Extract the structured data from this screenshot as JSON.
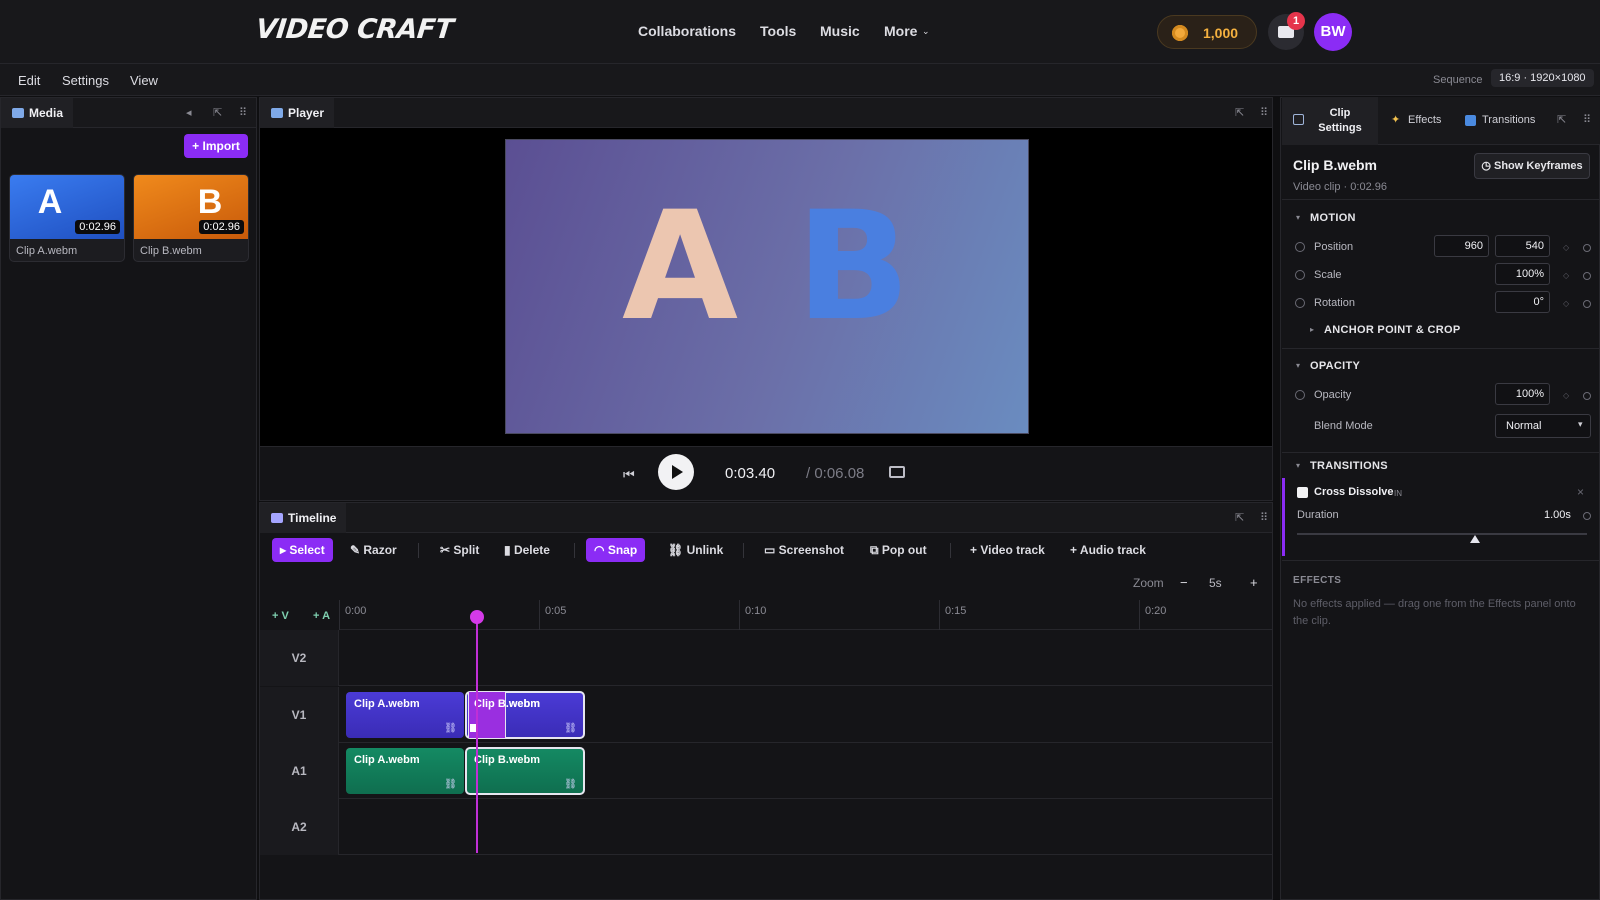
{
  "app": {
    "logo": "VIDEO CRAFT",
    "nav": [
      "Collaborations",
      "Tools",
      "Music",
      "More"
    ],
    "coins": "1,000",
    "notifications": "1",
    "avatar_initials": "BW"
  },
  "menubar": {
    "items": [
      "Edit",
      "Settings",
      "View"
    ],
    "sequence_label": "Sequence",
    "sequence_value": "16:9 · 1920×1080"
  },
  "media": {
    "tab": "Media",
    "import_label": "+ Import",
    "items": [
      {
        "letter": "A",
        "name": "Clip A.webm",
        "duration": "0:02.96",
        "color": "#2f6be0"
      },
      {
        "letter": "B",
        "name": "Clip B.webm",
        "duration": "0:02.96",
        "color": "#e8740f"
      }
    ]
  },
  "player": {
    "tab": "Player",
    "letter_a": "A",
    "letter_b": "B",
    "current_time": "0:03.40",
    "total_time": "/ 0:06.08"
  },
  "timeline": {
    "tab": "Timeline",
    "tools": [
      "Select",
      "Razor",
      "Split",
      "Delete",
      "Snap",
      "Unlink",
      "Screenshot",
      "Pop out",
      "+ Video track",
      "+ Audio track"
    ],
    "zoom_label": "Zoom",
    "zoom_minus": "−",
    "zoom_value": "5s",
    "zoom_plus": "+",
    "add_video": "+ V",
    "add_audio": "+ A",
    "ruler_labels": [
      "0:00",
      "0:05",
      "0:10",
      "0:15",
      "0:20"
    ],
    "tracks": [
      "V2",
      "V1",
      "A1",
      "A2"
    ],
    "clips": {
      "v1_a": "Clip A.webm",
      "v1_b": "Clip B.webm",
      "a1_a": "Clip A.webm",
      "a1_b": "Clip B.webm"
    }
  },
  "inspector": {
    "tabs": [
      "Clip Settings",
      "Effects",
      "Transitions"
    ],
    "clip_title": "Clip B.webm",
    "clip_subtitle": "Video clip · 0:02.96",
    "show_keyframes": "Show Keyframes",
    "motion": {
      "header": "MOTION",
      "position_label": "Position",
      "position_x": "960",
      "position_y": "540",
      "scale_label": "Scale",
      "scale": "100%",
      "rotation_label": "Rotation",
      "rotation": "0°",
      "anchor_header": "ANCHOR POINT & CROP"
    },
    "opacity": {
      "header": "OPACITY",
      "opacity_label": "Opacity",
      "opacity": "100%",
      "blend_label": "Blend Mode",
      "blend_value": "Normal"
    },
    "transitions": {
      "header": "TRANSITIONS",
      "name": "Cross Dissolve",
      "tag": "IN",
      "duration_label": "Duration",
      "duration_value": "1.00s"
    },
    "effects": {
      "header": "EFFECTS",
      "empty": "No effects applied — drag one from the Effects panel onto the clip."
    }
  }
}
